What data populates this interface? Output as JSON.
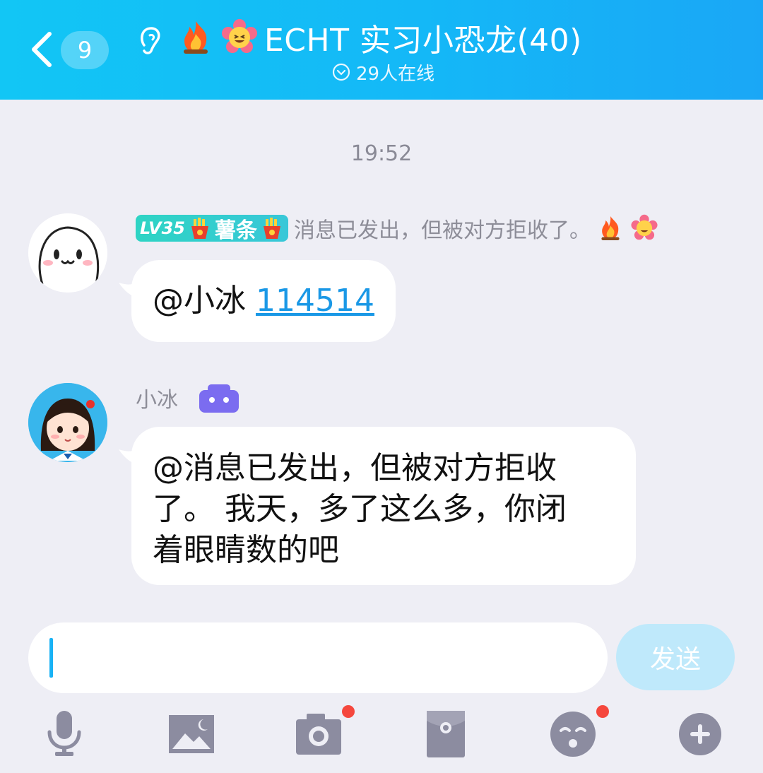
{
  "header": {
    "unread_count": "9",
    "title": "ECHT 实习小恐龙(40)",
    "online_status": "29人在线"
  },
  "chat": {
    "timestamp": "19:52",
    "messages": [
      {
        "level": "LV35",
        "tag_name": "薯条",
        "sender": "消息已发出，但被对方拒收了。",
        "mention": "@小冰",
        "link_text": "114514"
      },
      {
        "sender": "小冰",
        "text": "@消息已发出，但被对方拒收了。 我天，多了这么多，你闭着眼睛数的吧",
        "line1": "@消息已发出，但被对方拒收",
        "line2": "了。 我天，多了这么多，你闭",
        "line3": "着眼睛数的吧"
      }
    ]
  },
  "composer": {
    "input_value": "",
    "send_label": "发送"
  },
  "toolbar": {
    "items": [
      "mic-icon",
      "image-icon",
      "camera-icon",
      "red-packet-icon",
      "emoji-face-icon",
      "plus-icon"
    ]
  },
  "colors": {
    "header_gradient_start": "#12c6f5",
    "header_gradient_end": "#1aa7f6",
    "link": "#1a98e6",
    "badge_red": "#f5473d",
    "send_button": "#bfe9fb"
  }
}
